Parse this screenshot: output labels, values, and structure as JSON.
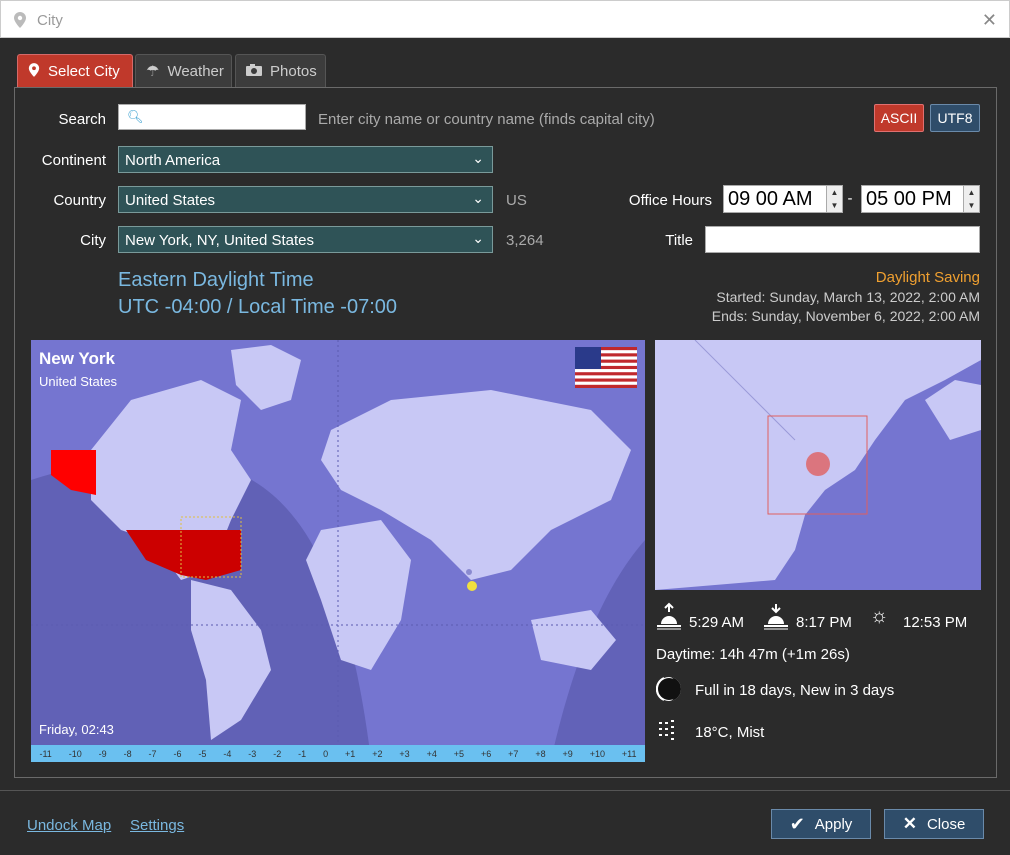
{
  "window": {
    "title": "City"
  },
  "tabs": [
    {
      "label": "Select City"
    },
    {
      "label": "Weather"
    },
    {
      "label": "Photos"
    }
  ],
  "form": {
    "search_label": "Search",
    "search_value": "",
    "search_hint": "Enter city name or country name (finds capital city)",
    "ascii_label": "ASCII",
    "utf8_label": "UTF8",
    "continent_label": "Continent",
    "continent_value": "North America",
    "country_label": "Country",
    "country_value": "United States",
    "country_code": "US",
    "city_label": "City",
    "city_value": "New York, NY, United States",
    "city_count": "3,264",
    "office_hours_label": "Office Hours",
    "office_start": "09 00 AM",
    "office_dash": "-",
    "office_end": "05 00 PM",
    "title_label": "Title",
    "title_value": ""
  },
  "timezone": {
    "name": "Eastern Daylight Time",
    "offset": "UTC -04:00 / Local Time -07:00",
    "dst_title": "Daylight Saving",
    "dst_started": "Started: Sunday, March 13, 2022, 2:00 AM",
    "dst_ends": "Ends: Sunday, November 6, 2022, 2:00 AM"
  },
  "map": {
    "city": "New York",
    "country": "United States",
    "time": "Friday, 02:43",
    "scale": [
      "-11",
      "-10",
      "-9",
      "-8",
      "-7",
      "-6",
      "-5",
      "-4",
      "-3",
      "-2",
      "-1",
      "0",
      "+1",
      "+2",
      "+3",
      "+4",
      "+5",
      "+6",
      "+7",
      "+8",
      "+9",
      "+10",
      "+11"
    ]
  },
  "sun": {
    "sunrise": "5:29 AM",
    "sunset": "8:17 PM",
    "noon": "12:53 PM",
    "daytime": "Daytime: 14h 47m (+1m 26s)",
    "moon": "Full in 18 days, New in 3 days",
    "weather": "18°C, Mist"
  },
  "footer": {
    "undock": "Undock Map",
    "settings": "Settings",
    "apply": "Apply",
    "close": "Close"
  },
  "colors": {
    "accent_red": "#c0392b",
    "accent_blue": "#7ab8e0",
    "dst_orange": "#f0a030",
    "map_sea": "#7575d0"
  }
}
